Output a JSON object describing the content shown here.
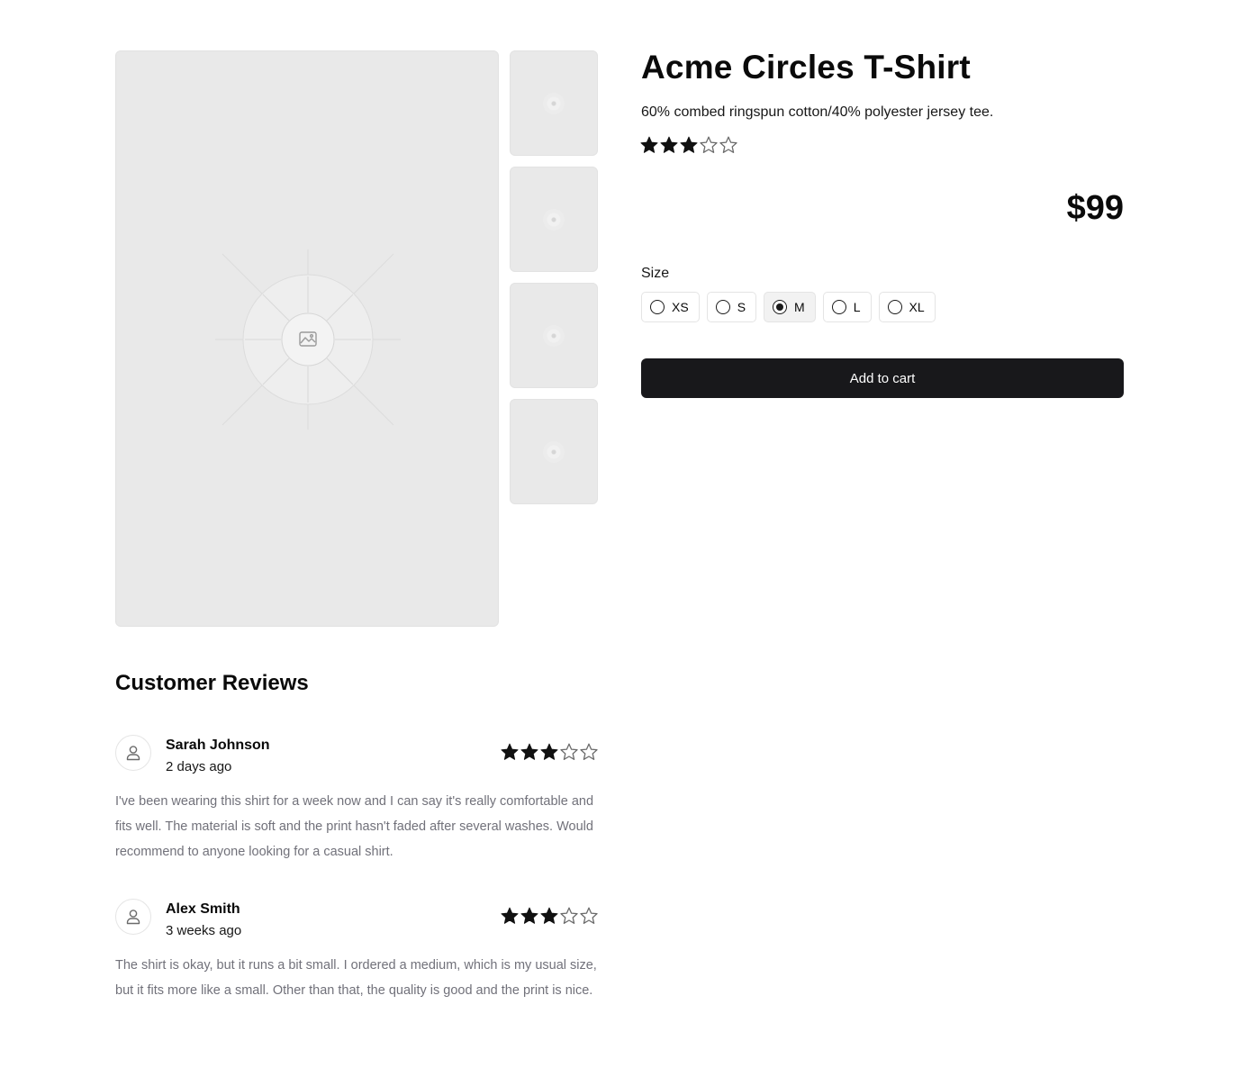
{
  "product": {
    "title": "Acme Circles T-Shirt",
    "description": "60% combed ringspun cotton/40% polyester jersey tee.",
    "rating": 3,
    "rating_max": 5,
    "price": "$99",
    "size_label": "Size",
    "sizes": [
      {
        "label": "XS",
        "selected": false
      },
      {
        "label": "S",
        "selected": false
      },
      {
        "label": "M",
        "selected": true
      },
      {
        "label": "L",
        "selected": false
      },
      {
        "label": "XL",
        "selected": false
      }
    ],
    "add_to_cart_label": "Add to cart",
    "gallery": {
      "main_icon": "image-placeholder-icon",
      "thumbnails": 4
    }
  },
  "reviews": {
    "heading": "Customer Reviews",
    "items": [
      {
        "name": "Sarah Johnson",
        "date": "2 days ago",
        "rating": 3,
        "text": "I've been wearing this shirt for a week now and I can say it's really comfortable and fits well. The material is soft and the print hasn't faded after several washes. Would recommend to anyone looking for a casual shirt."
      },
      {
        "name": "Alex Smith",
        "date": "3 weeks ago",
        "rating": 3,
        "text": "The shirt is okay, but it runs a bit small. I ordered a medium, which is my usual size, but it fits more like a small. Other than that, the quality is good and the print is nice."
      }
    ]
  },
  "colors": {
    "star_filled": "#111111",
    "star_empty": "#6b6b6b",
    "button_bg": "#18181b",
    "placeholder_bg": "#e9e9e9",
    "muted_text": "#71717a"
  }
}
